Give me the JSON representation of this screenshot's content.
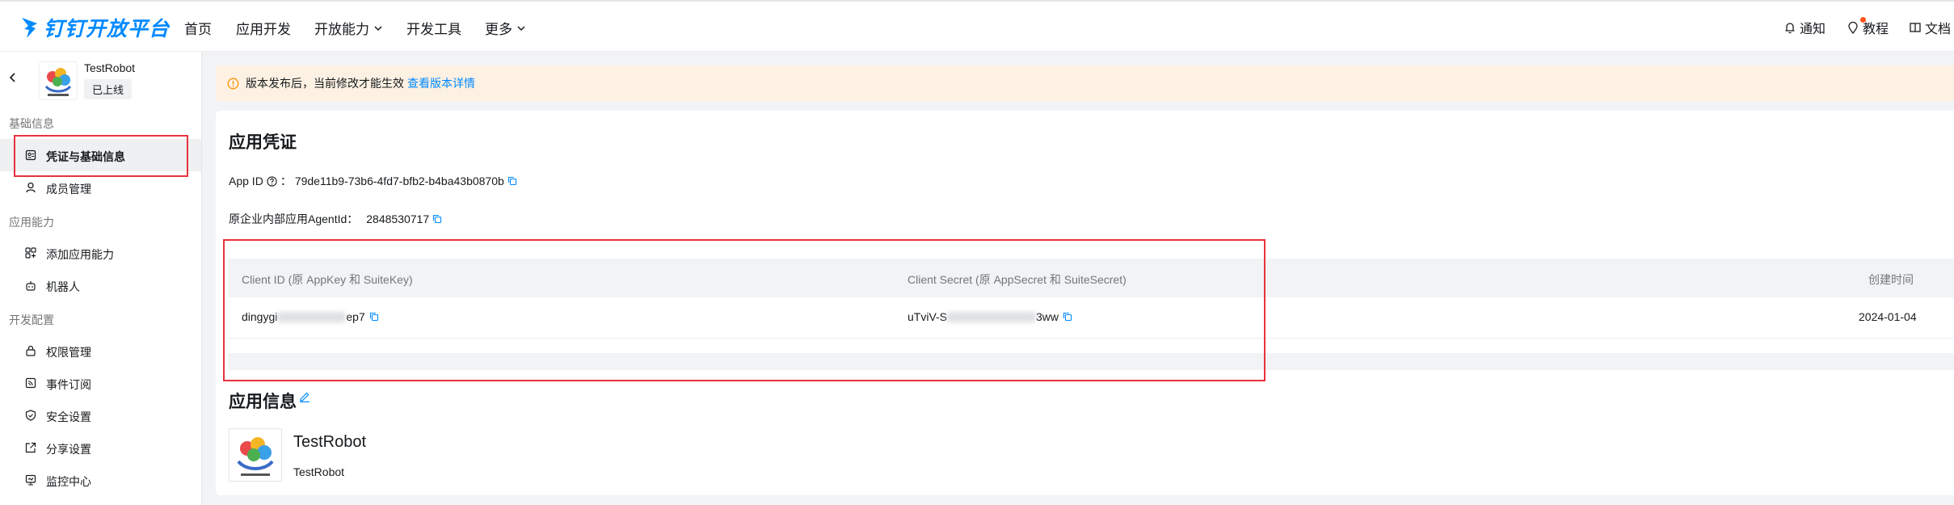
{
  "topnav": {
    "logo_text": "钉钉开放平台",
    "items": [
      "首页",
      "应用开发",
      "开放能力",
      "开发工具",
      "更多"
    ],
    "right": [
      "通知",
      "教程",
      "文档"
    ]
  },
  "sidebar": {
    "app_name": "TestRobot",
    "app_status": "已上线",
    "groups": [
      "基础信息",
      "应用能力",
      "开发配置"
    ],
    "items": [
      "凭证与基础信息",
      "成员管理",
      "添加应用能力",
      "机器人",
      "权限管理",
      "事件订阅",
      "安全设置",
      "分享设置",
      "监控中心"
    ]
  },
  "notice": {
    "text": "版本发布后，当前修改才能生效",
    "link": "查看版本详情"
  },
  "credentials": {
    "title": "应用凭证",
    "app_id_label": "App ID",
    "app_id_sep": "：",
    "app_id_value": "79de11b9-73b6-4fd7-bfb2-b4ba43b0870b",
    "agent_label": "原企业内部应用AgentId：",
    "agent_value": "2848530717",
    "table": {
      "headers": [
        "Client ID (原 AppKey 和 SuiteKey)",
        "Client Secret (原 AppSecret 和 SuiteSecret)",
        "创建时间"
      ],
      "client_id_prefix": "dingygi",
      "client_id_suffix": "ep7",
      "client_secret_prefix": "uTviV-S",
      "client_secret_suffix": "3ww",
      "created": "2024-01-04"
    }
  },
  "appinfo": {
    "title": "应用信息",
    "name": "TestRobot",
    "desc": "TestRobot"
  }
}
